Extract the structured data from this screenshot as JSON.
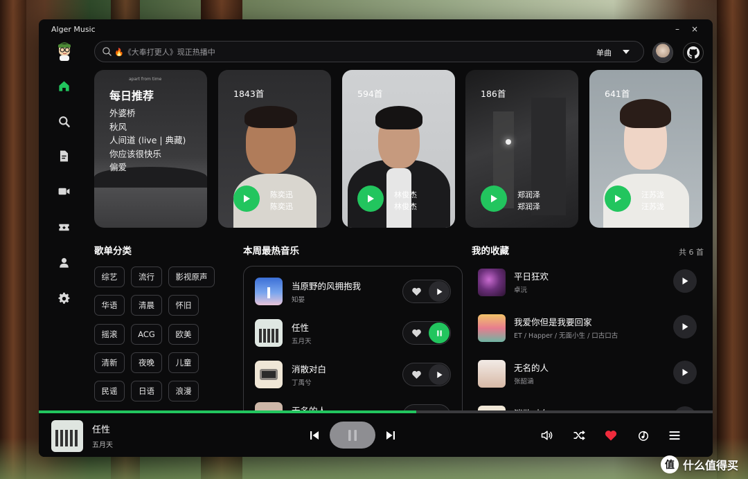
{
  "app": {
    "title": "Alger Music"
  },
  "window_controls": {
    "minimize": "–",
    "close": "×"
  },
  "sidebar": {
    "items": [
      {
        "name": "home-icon",
        "active": true
      },
      {
        "name": "search-icon",
        "active": false
      },
      {
        "name": "document-icon",
        "active": false
      },
      {
        "name": "video-icon",
        "active": false
      },
      {
        "name": "ticket-icon",
        "active": false
      },
      {
        "name": "user-icon",
        "active": false
      },
      {
        "name": "gear-icon",
        "active": false
      }
    ]
  },
  "search": {
    "placeholder": "🔥《大奉打更人》现正热播中",
    "type_label": "单曲"
  },
  "daily": {
    "title": "每日推荐",
    "songs": [
      "外婆桥",
      "秋风",
      "人间道 (live | 典藏)",
      "你应该很快乐",
      "偏爱"
    ],
    "art_text": "apart from time"
  },
  "artist_cards": [
    {
      "count": "1843首",
      "name_line1": "陈奕迅",
      "name_line2": "陈奕迅"
    },
    {
      "count": "594首",
      "name_line1": "林俊杰",
      "name_line2": "林俊杰"
    },
    {
      "count": "186首",
      "name_line1": "郑润泽",
      "name_line2": "郑润泽"
    },
    {
      "count": "641首",
      "name_line1": "汪苏泷",
      "name_line2": "汪苏泷"
    }
  ],
  "sections": {
    "categories_title": "歌单分类",
    "hot_title": "本周最热音乐",
    "fav_title": "我的收藏",
    "fav_count": "共 6 首"
  },
  "tags": [
    "综艺",
    "流行",
    "影视原声",
    "华语",
    "清晨",
    "怀旧",
    "摇滚",
    "ACG",
    "欧美",
    "清新",
    "夜晚",
    "儿童",
    "民谣",
    "日语",
    "浪漫"
  ],
  "hot_songs": [
    {
      "title": "当原野的风拥抱我",
      "artist": "知晏",
      "playing": false
    },
    {
      "title": "任性",
      "artist": "五月天",
      "playing": true
    },
    {
      "title": "消散对白",
      "artist": "丁禹兮",
      "playing": false
    },
    {
      "title": "无名的人",
      "artist": "",
      "playing": false
    }
  ],
  "favorites": [
    {
      "title": "平日狂欢",
      "artist": "卓沅"
    },
    {
      "title": "我爱你但是我要回家",
      "artist": "ET / Happer / 无面小生 / 口古口古"
    },
    {
      "title": "无名的人",
      "artist": "张韶涵"
    },
    {
      "title": "消散对白",
      "artist": ""
    }
  ],
  "player": {
    "title": "任性",
    "artist": "五月天",
    "progress": 0.56,
    "accent": "#22c55e",
    "liked_color": "#ef2b3c"
  },
  "watermark": {
    "badge": "值",
    "text": "什么值得买"
  }
}
